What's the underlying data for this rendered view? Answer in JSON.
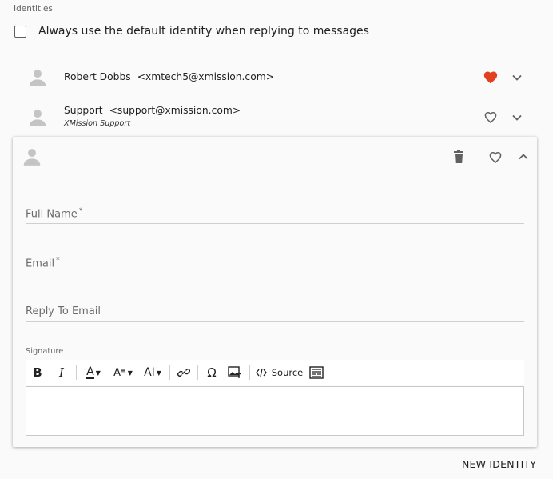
{
  "section": {
    "title": "Identities"
  },
  "default_identity": {
    "label": "Always use the default identity when replying to messages",
    "checked": false
  },
  "identities": [
    {
      "name": "Robert Dobbs",
      "email": "<xmtech5@xmission.com>",
      "subtitle": "",
      "is_default": true
    },
    {
      "name": "Support",
      "email": "<support@xmission.com>",
      "subtitle": "XMission Support",
      "is_default": false
    }
  ],
  "editor": {
    "fields": {
      "full_name": "Full Name",
      "email": "Email",
      "reply_to": "Reply To Email",
      "required_mark": "*"
    },
    "signature_label": "Signature",
    "toolbar": {
      "bold": "B",
      "italic": "I",
      "font_color": "A",
      "font_family": "A",
      "font_size": "AI",
      "special_char": "Ω",
      "source": "Source"
    }
  },
  "actions": {
    "new_identity": "NEW IDENTITY"
  },
  "colors": {
    "favorite_active": "#e0411f",
    "icon": "#616161"
  }
}
